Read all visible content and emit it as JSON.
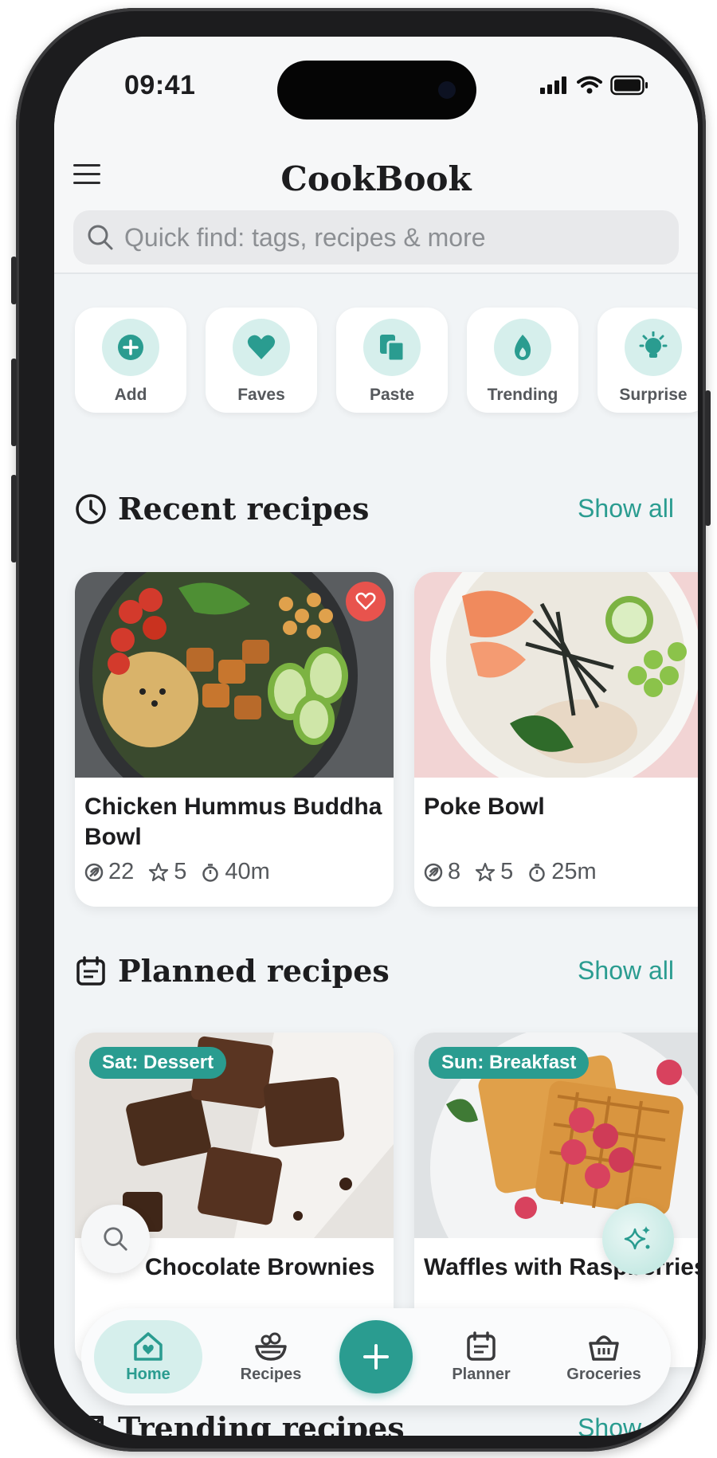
{
  "status_bar": {
    "time": "09:41"
  },
  "header": {
    "title": "CookBook",
    "search_placeholder": "Quick find: tags, recipes & more"
  },
  "quick_actions": [
    {
      "label": "Add",
      "icon": "plus-circle-icon"
    },
    {
      "label": "Faves",
      "icon": "heart-icon"
    },
    {
      "label": "Paste",
      "icon": "paste-icon"
    },
    {
      "label": "Trending",
      "icon": "flame-icon"
    },
    {
      "label": "Surprise",
      "icon": "lightbulb-icon"
    }
  ],
  "sections": {
    "recent": {
      "title": "Recent recipes",
      "show_all": "Show all"
    },
    "planned": {
      "title": "Planned recipes",
      "show_all": "Show all"
    },
    "trending": {
      "title": "Trending recipes",
      "show_all": "Show all"
    }
  },
  "recent_recipes": [
    {
      "title": "Chicken Hummus Buddha Bowl",
      "ingredients": "22",
      "rating": "5",
      "time": "40m",
      "favorite": true
    },
    {
      "title": "Poke Bowl",
      "ingredients": "8",
      "rating": "5",
      "time": "25m",
      "favorite": true
    }
  ],
  "planned_recipes": [
    {
      "badge": "Sat: Dessert",
      "title": "Chocolate Brownies"
    },
    {
      "badge": "Sun: Breakfast",
      "title": "Waffles with Raspberries"
    }
  ],
  "tabbar": {
    "items": [
      {
        "label": "Home",
        "icon": "home-icon",
        "active": true
      },
      {
        "label": "Recipes",
        "icon": "bowl-icon",
        "active": false
      },
      {
        "label": "Planner",
        "icon": "calendar-icon",
        "active": false
      },
      {
        "label": "Groceries",
        "icon": "basket-icon",
        "active": false
      }
    ]
  },
  "colors": {
    "accent": "#2a9c90",
    "accent_light": "#d6efec",
    "favorite": "#e8534d",
    "background": "#f1f4f6"
  }
}
